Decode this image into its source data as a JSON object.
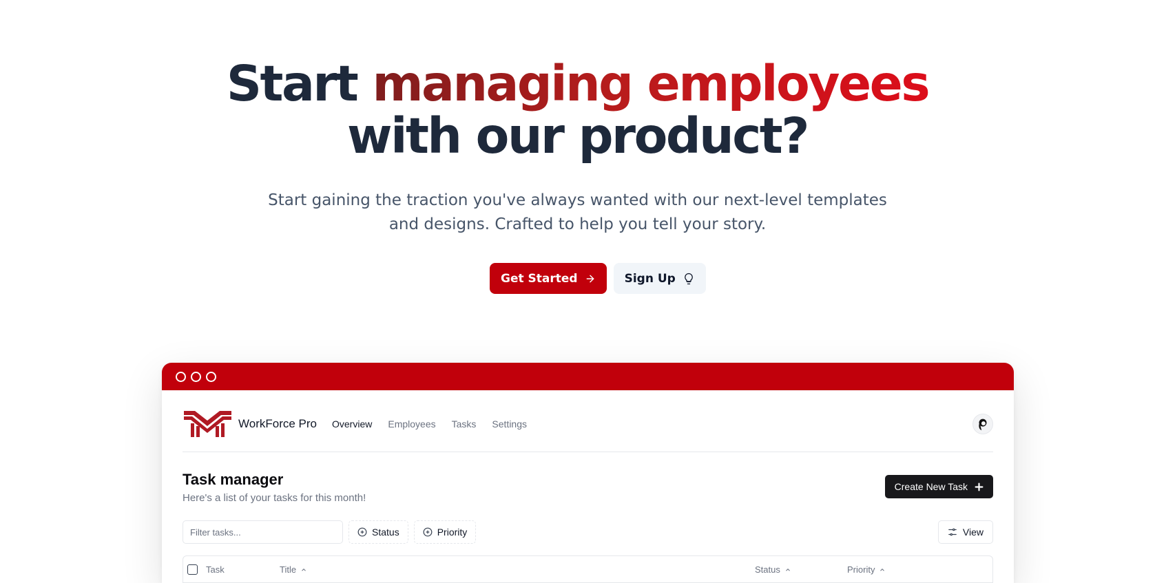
{
  "hero": {
    "headline_start": "Start ",
    "headline_highlight": "managing employees",
    "headline_end": "with our product?",
    "subtitle_line1": "Start gaining the traction you've always wanted with our next-level templates",
    "subtitle_line2": "and designs. Crafted to help you tell your story.",
    "primary_cta": "Get Started",
    "secondary_cta": "Sign Up"
  },
  "colors": {
    "brand_red": "#c1000b",
    "headline_dark": "#1e293b"
  },
  "app": {
    "brand_name": "WorkForce Pro",
    "nav": [
      "Overview",
      "Employees",
      "Tasks",
      "Settings"
    ],
    "active_nav": "Overview",
    "page_title": "Task manager",
    "page_description": "Here's a list of your tasks for this month!",
    "create_button": "Create New Task",
    "filter_placeholder": "Filter tasks...",
    "filters": [
      "Status",
      "Priority"
    ],
    "view_button": "View",
    "table_columns": [
      "Task",
      "Title",
      "Status",
      "Priority"
    ]
  },
  "icons": {
    "primary_cta": "arrow-right-icon",
    "secondary_cta": "lightbulb-icon",
    "create": "plus-icon",
    "filter": "plus-circle-icon",
    "view": "sliders-icon",
    "sort": "chevron-up-icon"
  }
}
